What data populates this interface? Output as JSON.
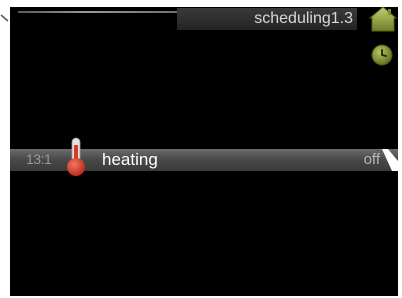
{
  "header": {
    "title": "scheduling1.3",
    "home_icon": "home-icon",
    "clock_icon": "clock-icon"
  },
  "menu": {
    "rows": [
      {
        "number": "13:1",
        "icon": "thermometer-icon",
        "label": "heating",
        "value": "off"
      }
    ]
  },
  "colors": {
    "background": "#000000",
    "icon_green": "#8a9a3c",
    "thermometer_red": "#d8392a"
  }
}
